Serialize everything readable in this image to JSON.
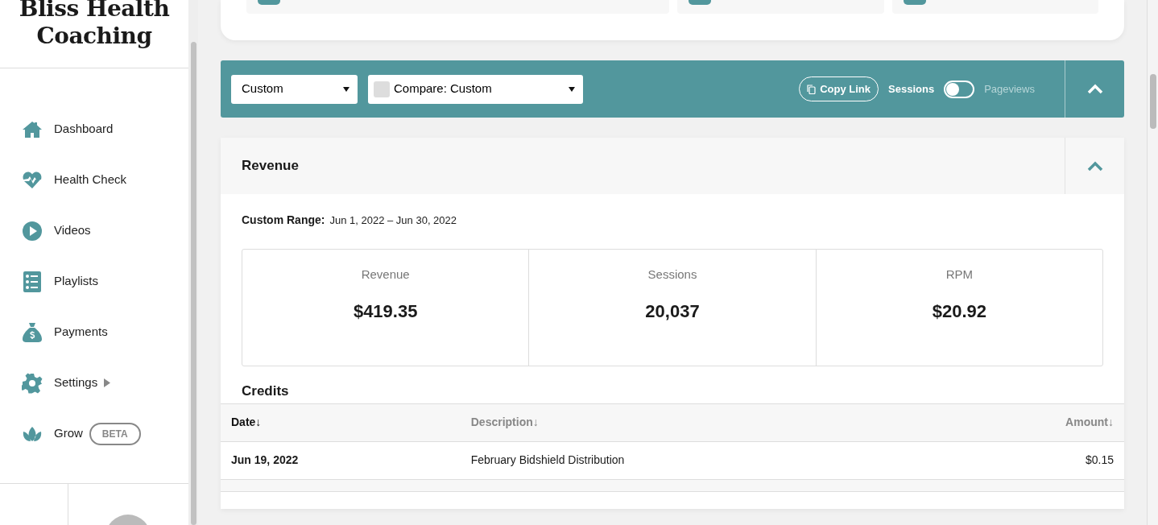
{
  "brand": {
    "title": "Bliss Health Coaching"
  },
  "sidebar": {
    "items": [
      {
        "label": "Dashboard",
        "selected": false
      },
      {
        "label": "Health Check",
        "selected": false
      },
      {
        "label": "Videos",
        "selected": false
      },
      {
        "label": "Playlists",
        "selected": false
      },
      {
        "label": "Payments",
        "selected": false
      },
      {
        "label": "Settings",
        "selected": false,
        "submenu": true
      },
      {
        "label": "Grow",
        "selected": false,
        "badge": "BETA"
      }
    ]
  },
  "filter_bar": {
    "range": "Custom",
    "compare": "Compare: Custom",
    "copy_link": "Copy Link",
    "metric_toggle": {
      "on": false,
      "options": [
        {
          "label": "Sessions",
          "selected": true
        },
        {
          "label": "Pageviews",
          "selected": false
        }
      ]
    },
    "expanded": true
  },
  "revenue_panel": {
    "title": "Revenue",
    "expanded": true,
    "range_label": "Custom Range:",
    "range_value": "Jun 1, 2022 – Jun 30, 2022",
    "stats": [
      {
        "label": "Revenue",
        "value": "$419.35"
      },
      {
        "label": "Sessions",
        "value": "20,037"
      },
      {
        "label": "RPM",
        "value": "$20.92"
      }
    ],
    "credits": {
      "title": "Credits",
      "columns": [
        {
          "label": "Date↓",
          "selected": true
        },
        {
          "label": "Description↓",
          "selected": false
        },
        {
          "label": "Amount↓",
          "selected": false
        }
      ],
      "rows": [
        [
          "Jun 19, 2022",
          "February Bidshield Distribution",
          "$0.15"
        ]
      ]
    }
  }
}
